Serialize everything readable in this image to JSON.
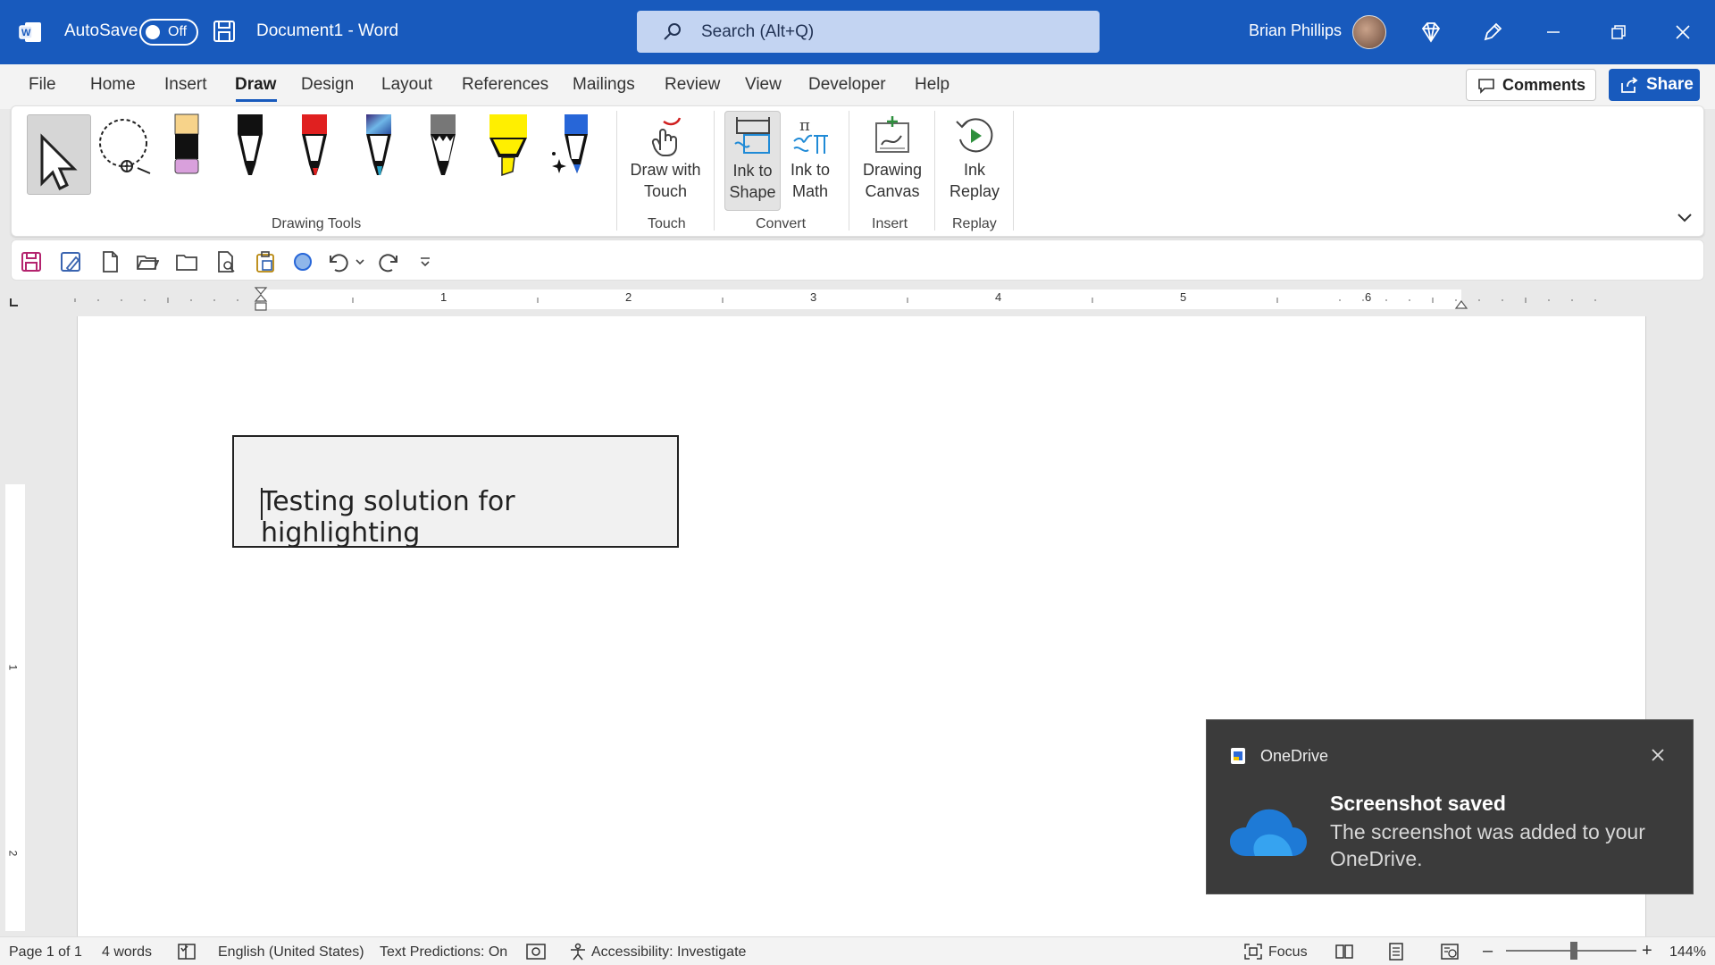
{
  "titlebar": {
    "autosave_label": "AutoSave",
    "autosave_state": "Off",
    "document_title": "Document1  -  Word",
    "search_placeholder": "Search (Alt+Q)",
    "user_name": "Brian Phillips"
  },
  "menu": {
    "tabs": [
      "File",
      "Home",
      "Insert",
      "Draw",
      "Design",
      "Layout",
      "References",
      "Mailings",
      "Review",
      "View",
      "Developer",
      "Help"
    ],
    "active_tab": "Draw",
    "comments_label": "Comments",
    "share_label": "Share"
  },
  "ribbon": {
    "groups": {
      "drawing_tools": "Drawing Tools",
      "touch": "Touch",
      "convert": "Convert",
      "insert": "Insert",
      "replay": "Replay"
    },
    "buttons": {
      "draw_with_touch": [
        "Draw with",
        "Touch"
      ],
      "ink_to_shape": [
        "Ink to",
        "Shape"
      ],
      "ink_to_math": [
        "Ink to",
        "Math"
      ],
      "drawing_canvas": [
        "Drawing",
        "Canvas"
      ],
      "ink_replay": [
        "Ink",
        "Replay"
      ]
    }
  },
  "ruler": {
    "numbers": [
      "1",
      "2",
      "3",
      "4",
      "5",
      "6"
    ],
    "vertical_numbers": [
      "1",
      "2"
    ]
  },
  "document": {
    "textbox_text": "Testing solution for highlighting"
  },
  "toast": {
    "app_name": "OneDrive",
    "title": "Screenshot saved",
    "body": "The screenshot was added to your OneDrive."
  },
  "statusbar": {
    "page": "Page 1 of 1",
    "words": "4 words",
    "language": "English (United States)",
    "text_predictions": "Text Predictions: On",
    "accessibility": "Accessibility: Investigate",
    "focus": "Focus",
    "zoom": "144%"
  },
  "colors": {
    "titlebar": "#185abd",
    "accent": "#185abd",
    "toast_bg": "#3b3b3b"
  }
}
